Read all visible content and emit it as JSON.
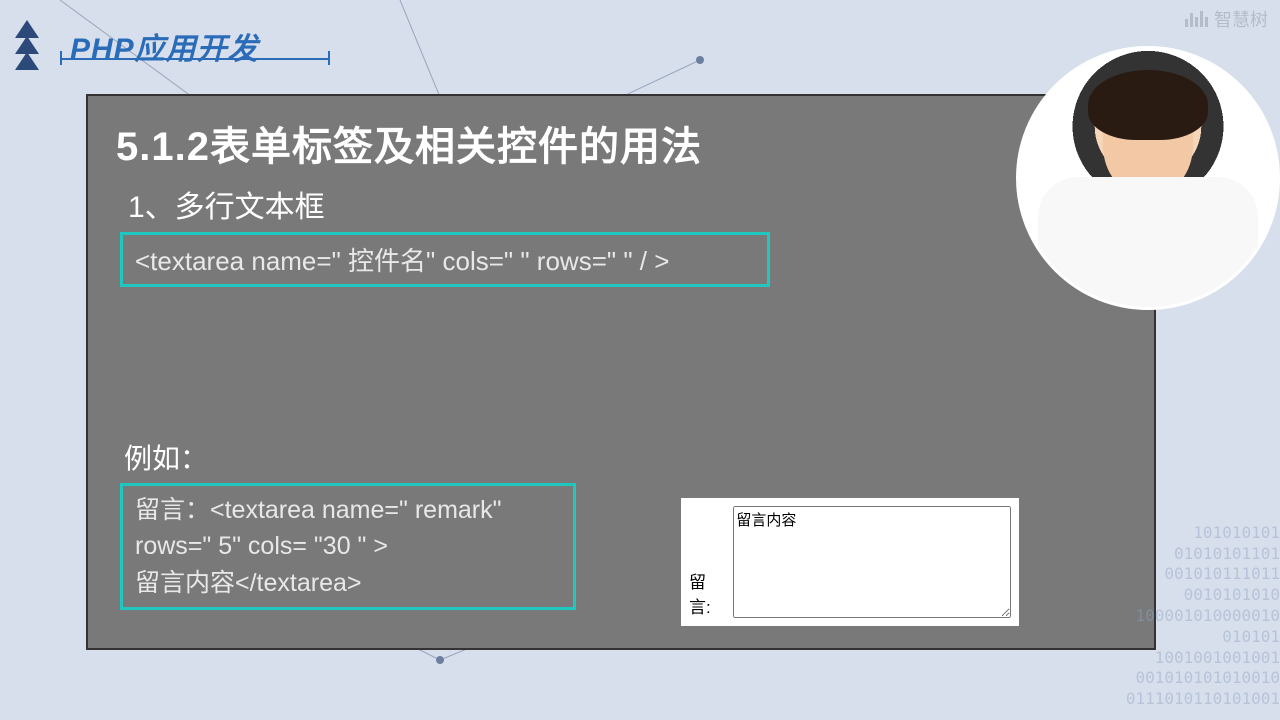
{
  "header": {
    "course_title": "PHP应用开发"
  },
  "watermark": {
    "text": "智慧树"
  },
  "slide": {
    "heading": "5.1.2表单标签及相关控件的用法",
    "subtitle": "1、多行文本框",
    "code_syntax": "<textarea name=\" 控件名\"  cols=\" \"    rows=\" \"    / >",
    "example_label": "例如：",
    "code_example": "留言：<textarea  name=\" remark\"\n rows=\"  5\"    cols=  \"30 \"    >\n留言内容</textarea>",
    "demo": {
      "label": "留言:",
      "textarea_value": "留言内容"
    }
  },
  "decor": {
    "binary": "101010101\n01010101101\n001010111011\n0010101010\n100001010000010\n010101\n1001001001001\n001010101010010\n0111010110101001"
  }
}
